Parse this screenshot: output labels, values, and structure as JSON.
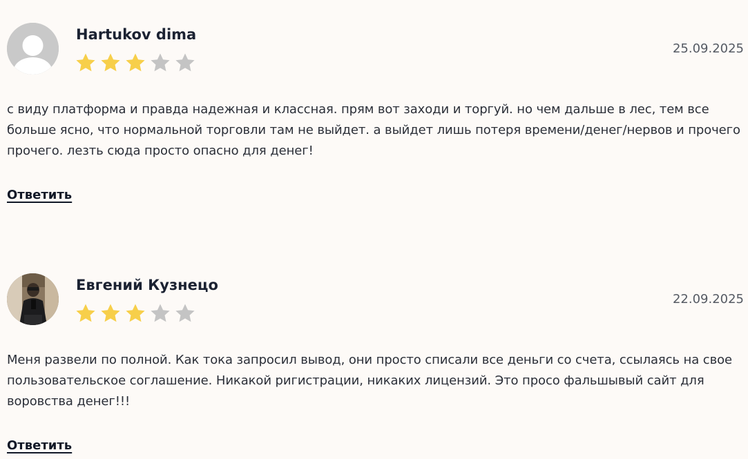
{
  "colors": {
    "background": "#fdfaf7",
    "star_filled": "#f7cf4a",
    "star_empty": "#c4c4c4",
    "text": "#2b2f38",
    "author": "#1b2232",
    "date": "#555a63"
  },
  "reviews": [
    {
      "author": "Hartukov dima",
      "avatar": "default-user-avatar",
      "rating": 3,
      "rating_max": 5,
      "date": "25.09.2025",
      "text": "с виду платформа и правда надежная и классная. прям вот заходи и торгуй. но чем дальше в лес, тем все больше ясно, что нормальной торговли там не выйдет. а выйдет лишь потеря времени/денег/нервов и прочего прочего. лезть сюда просто опасно для денег!",
      "reply_label": "Ответить"
    },
    {
      "author": "Евгений Кузнецо",
      "avatar": "user-photo-avatar",
      "rating": 3,
      "rating_max": 5,
      "date": "22.09.2025",
      "text": "Меня развели по полной. Как тока запросил вывод, они просто списали все деньги со счета, ссылаясь на свое пользовательское соглашение. Никакой ригистрации, никаких лицензий. Это просо фальшывый сайт для воровства денег!!!",
      "reply_label": "Ответить"
    }
  ]
}
